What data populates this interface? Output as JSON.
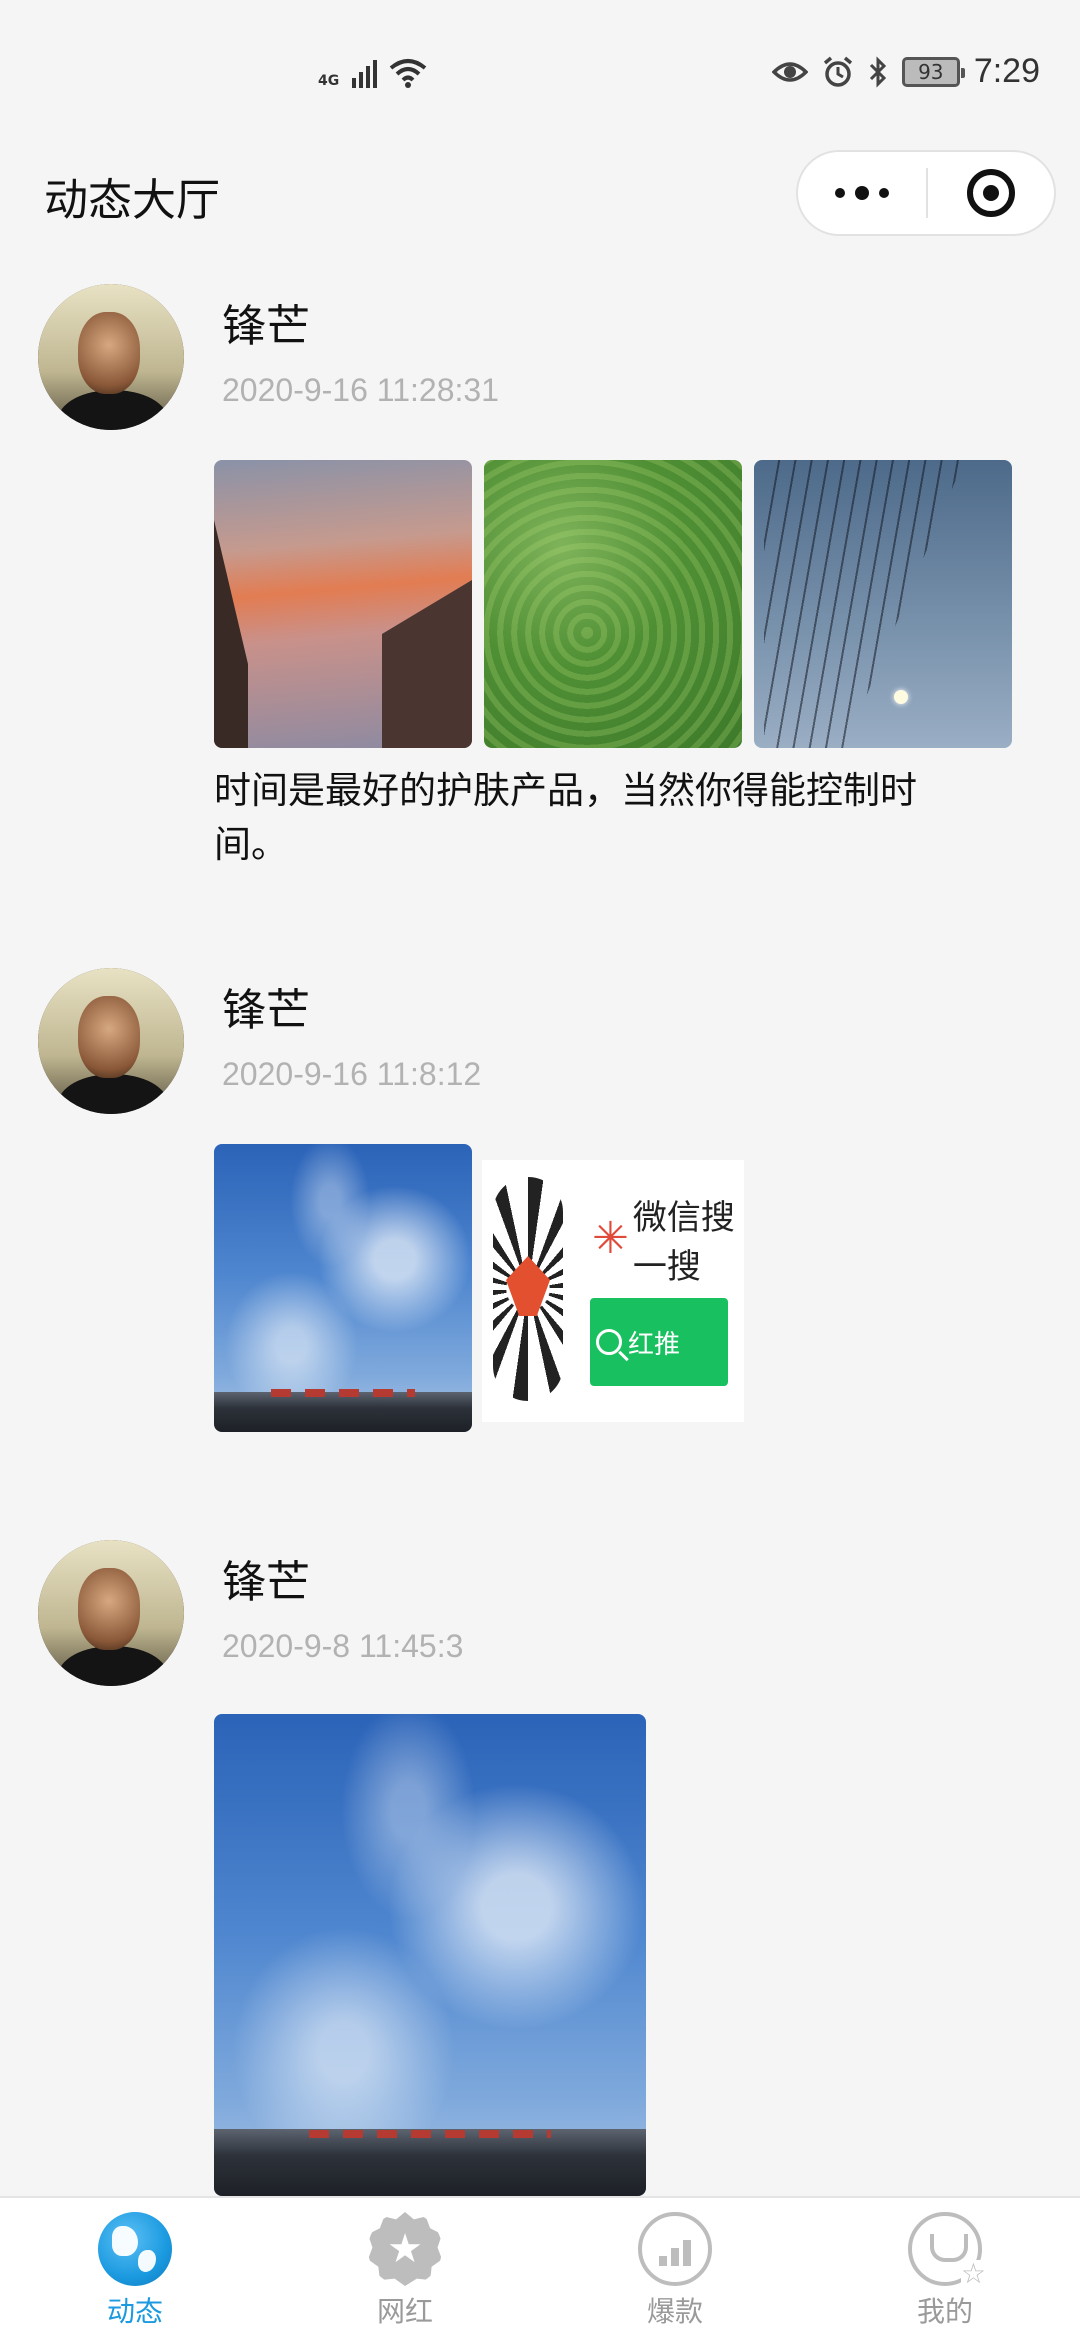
{
  "status_bar": {
    "network": "4G",
    "battery": "93",
    "time": "7:29"
  },
  "nav": {
    "title": "动态大厅"
  },
  "posts": [
    {
      "author": "锋芒",
      "time": "2020-9-16 11:28:31",
      "text": "时间是最好的护肤产品，当然你得能控制时间。",
      "images": [
        "sunset-clouds-photo",
        "green-shrubs-photo",
        "night-sky-willow-photo"
      ]
    },
    {
      "author": "锋芒",
      "time": "2020-9-16 11:8:12",
      "images": [
        "blue-sky-building-photo",
        "mini-program-qr-card"
      ],
      "qr_card": {
        "search_label": "微信搜一搜",
        "button_label": "红推"
      }
    },
    {
      "author": "锋芒",
      "time": "2020-9-8 11:45:3",
      "images": [
        "blue-sky-building-photo-large"
      ]
    }
  ],
  "tabbar": {
    "active": "dynamics",
    "tabs": [
      {
        "label": "动态",
        "icon": "globe-icon"
      },
      {
        "label": "网红",
        "icon": "star-badge-icon"
      },
      {
        "label": "爆款",
        "icon": "chart-icon"
      },
      {
        "label": "我的",
        "icon": "user-icon"
      }
    ]
  },
  "colors": {
    "accent": "#1b9ae0",
    "inactive_tab": "#9a9a9a",
    "timestamp": "#b2b2b2",
    "wechat_green": "#18c05f"
  }
}
